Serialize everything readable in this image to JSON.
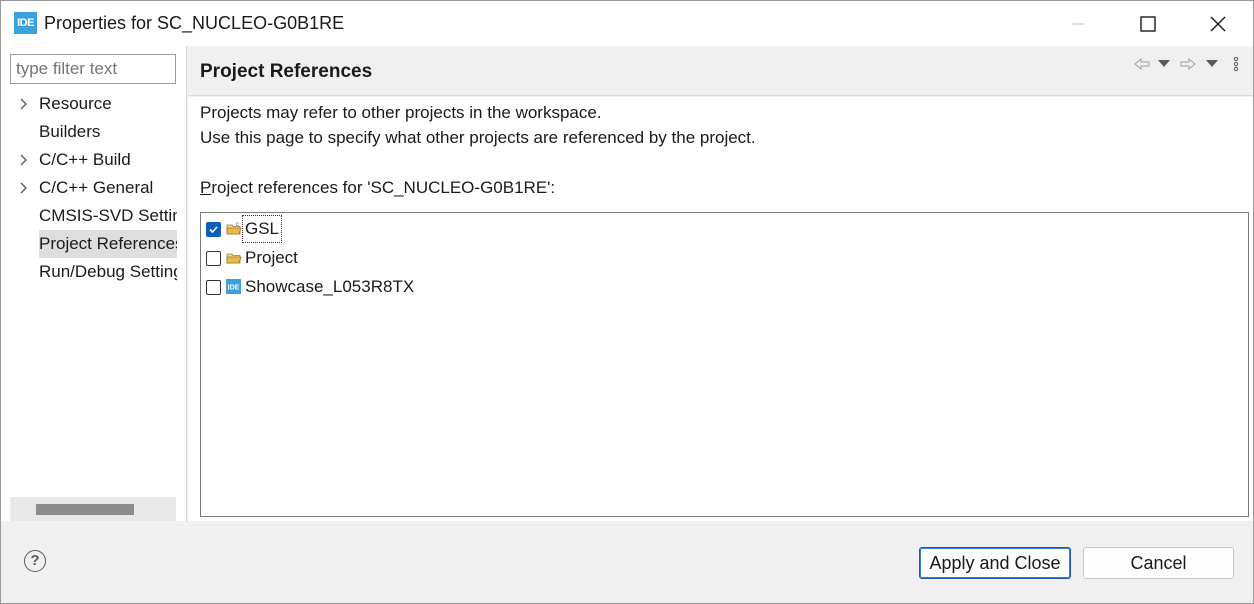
{
  "window": {
    "app_icon_text": "IDE",
    "title": "Properties for SC_NUCLEO-G0B1RE"
  },
  "sidebar": {
    "filter_placeholder": "type filter text",
    "items": [
      {
        "label": "Resource",
        "expandable": true
      },
      {
        "label": "Builders",
        "expandable": false
      },
      {
        "label": "C/C++ Build",
        "expandable": true
      },
      {
        "label": "C/C++ General",
        "expandable": true
      },
      {
        "label": "CMSIS-SVD Settings",
        "expandable": false
      },
      {
        "label": "Project References",
        "expandable": false,
        "selected": true
      },
      {
        "label": "Run/Debug Settings",
        "expandable": false
      }
    ]
  },
  "page": {
    "title": "Project References",
    "description_line1": "Projects may refer to other projects in the workspace.",
    "description_line2": "Use this page to specify what other projects are referenced by the project.",
    "references_label_mnemonic": "P",
    "references_label_rest": "roject references for 'SC_NUCLEO-G0B1RE':",
    "projects": [
      {
        "name": "GSL",
        "checked": true,
        "icon": "c-project-folder-icon"
      },
      {
        "name": "Project",
        "checked": false,
        "icon": "project-folder-icon"
      },
      {
        "name": "Showcase_L053R8TX",
        "checked": false,
        "icon": "ide-project-icon"
      }
    ]
  },
  "footer": {
    "help_glyph": "?",
    "apply_label": "Apply and Close",
    "cancel_label": "Cancel"
  },
  "colors": {
    "accent": "#0a5fbf",
    "app_icon": "#3aa0e0",
    "primary_border": "#1f5aa3"
  }
}
